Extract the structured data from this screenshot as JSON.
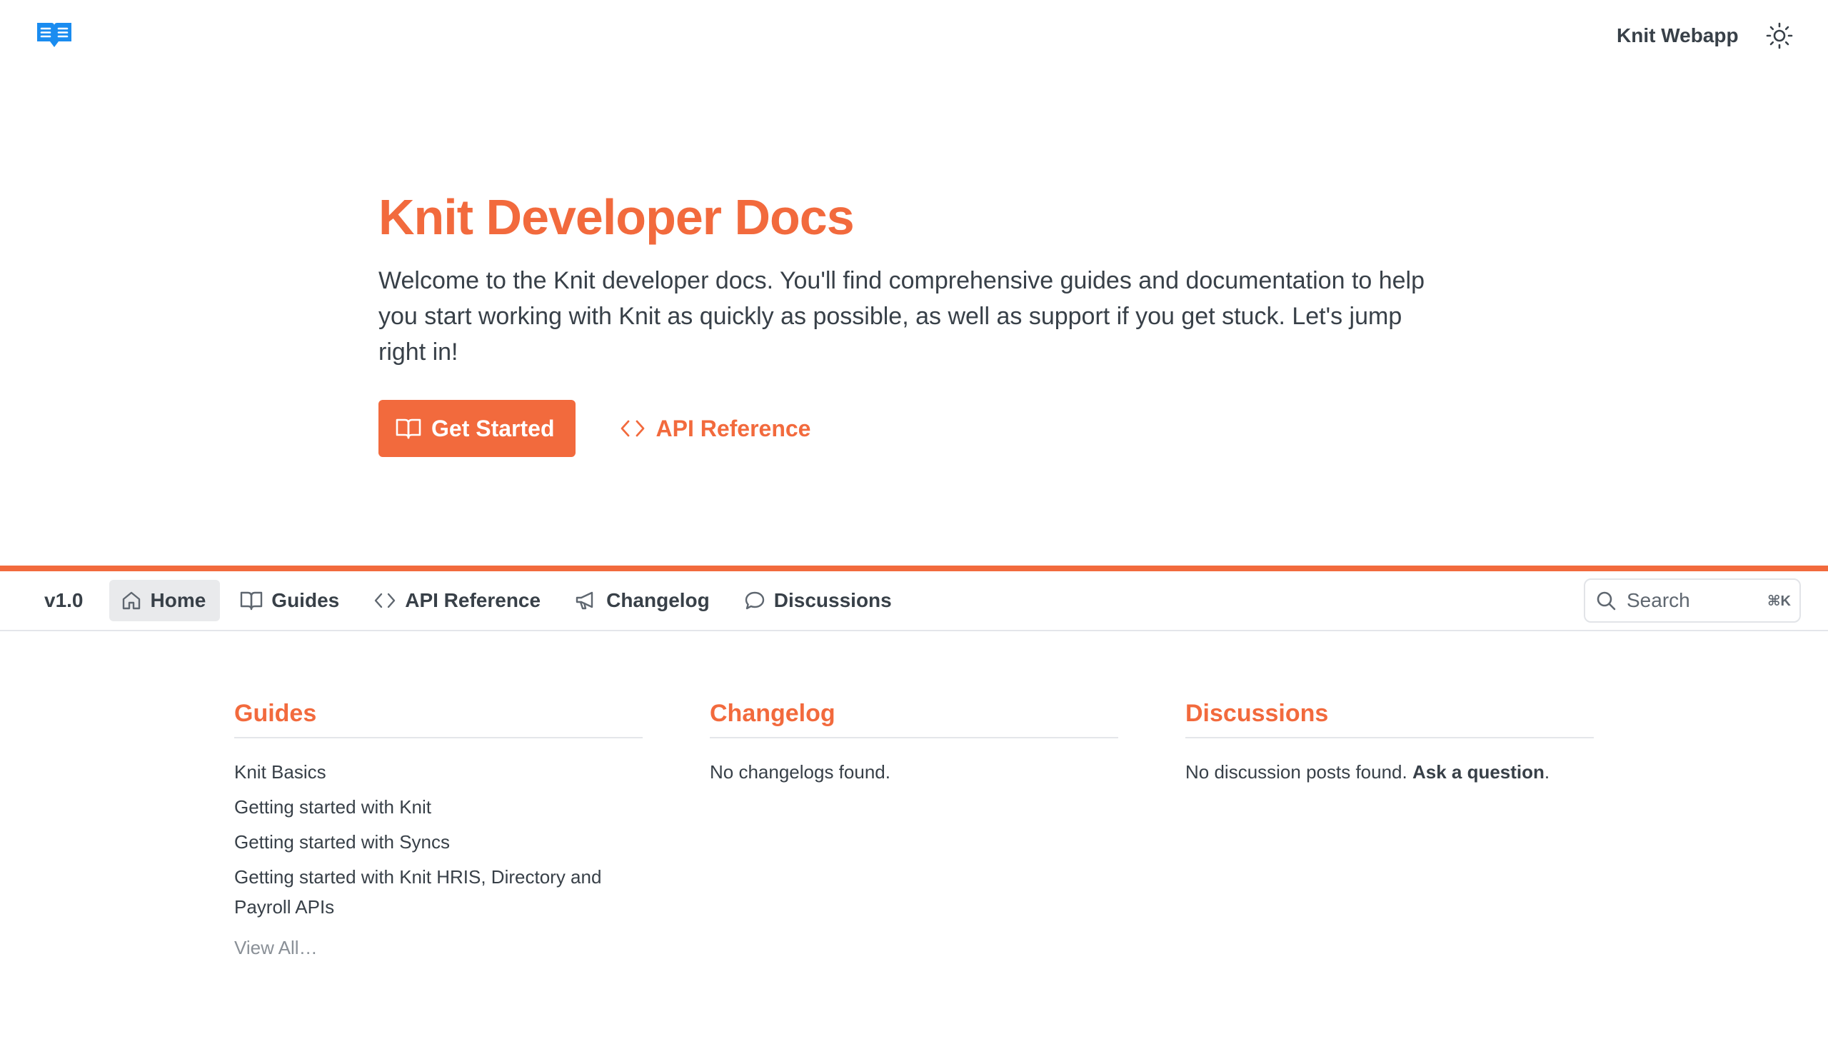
{
  "header": {
    "logo_icon": "book-logo-icon",
    "webapp_link": "Knit Webapp",
    "theme_icon": "sun-icon"
  },
  "hero": {
    "title": "Knit Developer Docs",
    "description": "Welcome to the Knit developer docs. You'll find comprehensive guides and documentation to help you start working with Knit as quickly as possible, as well as support if you get stuck. Let's jump right in!",
    "primary_button": {
      "label": "Get Started",
      "icon": "book-open-icon"
    },
    "secondary_button": {
      "label": "API Reference",
      "icon": "code-icon"
    }
  },
  "nav": {
    "version": "v1.0",
    "items": [
      {
        "label": "Home",
        "icon": "home-icon",
        "active": true
      },
      {
        "label": "Guides",
        "icon": "book-open-icon",
        "active": false
      },
      {
        "label": "API Reference",
        "icon": "code-icon",
        "active": false
      },
      {
        "label": "Changelog",
        "icon": "megaphone-icon",
        "active": false
      },
      {
        "label": "Discussions",
        "icon": "chat-bubble-icon",
        "active": false
      }
    ],
    "search": {
      "placeholder": "Search",
      "shortcut": "⌘K"
    }
  },
  "columns": {
    "guides": {
      "title": "Guides",
      "items": [
        "Knit Basics",
        "Getting started with Knit",
        "Getting started with Syncs",
        "Getting started with Knit HRIS, Directory and Payroll APIs"
      ],
      "view_all": "View All…"
    },
    "changelog": {
      "title": "Changelog",
      "empty": "No changelogs found."
    },
    "discussions": {
      "title": "Discussions",
      "empty": "No discussion posts found.",
      "cta": "Ask a question",
      "cta_suffix": "."
    }
  },
  "colors": {
    "accent": "#f26a3d",
    "logo_blue": "#1a8cf0",
    "text": "#384048",
    "muted": "#8a9097"
  }
}
